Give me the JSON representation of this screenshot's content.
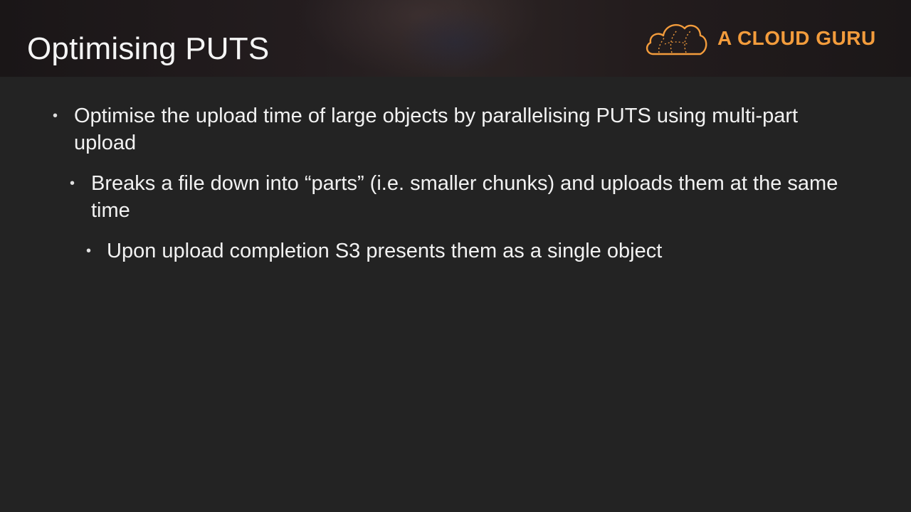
{
  "slide": {
    "title": "Optimising PUTS",
    "logo": {
      "text": "A CLOUD GURU",
      "icon": "cloud-icon",
      "color": "#f39c3c"
    },
    "bullets": [
      {
        "level": 1,
        "marker": "•",
        "text": "Optimise the upload time of large objects by parallelising PUTS using multi-part upload"
      },
      {
        "level": 2,
        "marker": "•",
        "text": "Breaks a file down into “parts” (i.e. smaller chunks) and uploads them at the same time"
      },
      {
        "level": 3,
        "marker": "•",
        "text": "Upon upload completion S3 presents them as a single object"
      }
    ]
  }
}
